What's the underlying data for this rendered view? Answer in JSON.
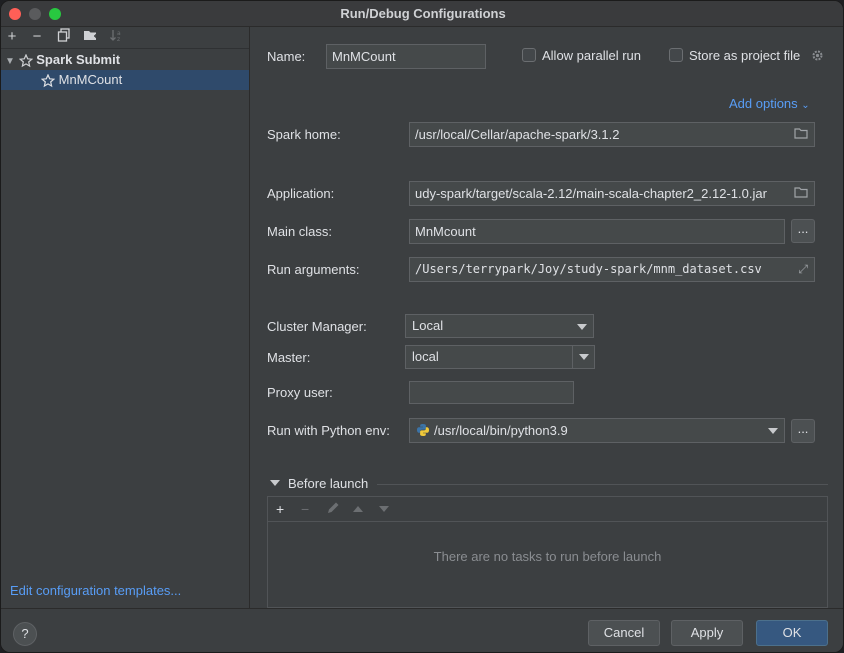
{
  "window": {
    "title": "Run/Debug Configurations"
  },
  "sidebar": {
    "toolbar": [
      "add-icon",
      "remove-icon",
      "copy-icon",
      "folder-add-icon",
      "sort-icon"
    ],
    "tree": {
      "group": "Spark Submit",
      "items": [
        {
          "label": "MnMCount",
          "selected": true
        }
      ]
    },
    "edit_templates": "Edit configuration templates..."
  },
  "main": {
    "name_label": "Name:",
    "name_value": "MnMCount",
    "allow_parallel": "Allow parallel run",
    "store_project": "Store as project file",
    "add_options": "Add options",
    "spark_home_label": "Spark home:",
    "spark_home_value": "/usr/local/Cellar/apache-spark/3.1.2",
    "application_label": "Application:",
    "application_value": "udy-spark/target/scala-2.12/main-scala-chapter2_2.12-1.0.jar",
    "main_class_label": "Main class:",
    "main_class_value": "MnMcount",
    "run_args_label": "Run arguments:",
    "run_args_value": "/Users/terrypark/Joy/study-spark/mnm_dataset.csv",
    "cluster_manager_label": "Cluster Manager:",
    "cluster_manager_value": "Local",
    "master_label": "Master:",
    "master_value": "local",
    "proxy_user_label": "Proxy user:",
    "proxy_user_value": "",
    "python_env_label": "Run with Python env:",
    "python_env_value": "/usr/local/bin/python3.9",
    "ellipsis": "...",
    "before_launch": {
      "title": "Before launch",
      "empty": "There are no tasks to run before launch"
    }
  },
  "footer": {
    "help": "?",
    "cancel": "Cancel",
    "apply": "Apply",
    "ok": "OK"
  },
  "colors": {
    "accent": "#589df6",
    "selection": "#2f4a6b",
    "primary_button": "#365880"
  }
}
